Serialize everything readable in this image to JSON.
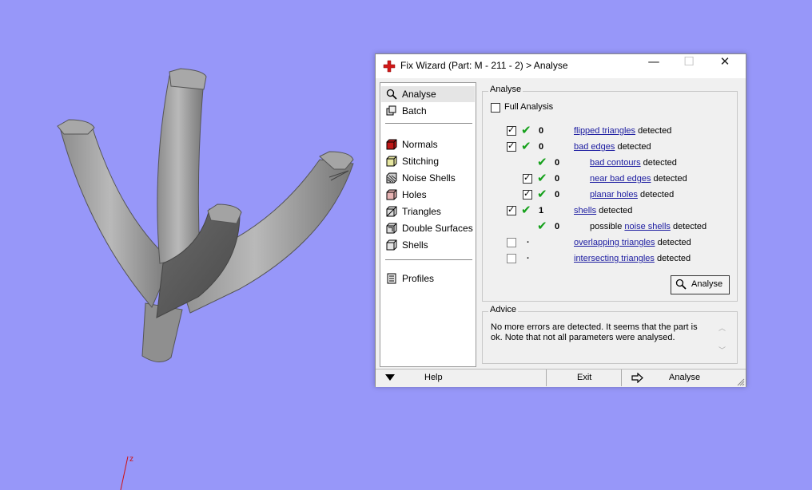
{
  "viewport": {
    "axis_label": "z"
  },
  "window": {
    "title": "Fix Wizard (Part: M - 211 - 2) > Analyse",
    "minimize_glyph": "—",
    "maximize_glyph": "☐",
    "close_glyph": "✕"
  },
  "sidebar": {
    "items": [
      {
        "label": "Analyse",
        "icon": "magnifier-icon"
      },
      {
        "label": "Batch",
        "icon": "batch-icon"
      },
      {
        "label": "Normals",
        "icon": "normals-cube-icon"
      },
      {
        "label": "Stitching",
        "icon": "stitching-cube-icon"
      },
      {
        "label": "Noise Shells",
        "icon": "noise-shells-icon"
      },
      {
        "label": "Holes",
        "icon": "holes-cube-icon"
      },
      {
        "label": "Triangles",
        "icon": "triangles-cube-icon"
      },
      {
        "label": "Double Surfaces",
        "icon": "double-surfaces-icon"
      },
      {
        "label": "Shells",
        "icon": "shells-cube-icon"
      },
      {
        "label": "Profiles",
        "icon": "profiles-icon"
      }
    ]
  },
  "analyse": {
    "legend": "Analyse",
    "full_analysis_label": "Full Analysis",
    "rows": [
      {
        "count": "0",
        "link": "flipped triangles",
        "suffix": " detected",
        "prefix": ""
      },
      {
        "count": "0",
        "link": "bad edges",
        "suffix": " detected",
        "prefix": ""
      },
      {
        "count": "0",
        "link": "bad contours",
        "suffix": " detected",
        "prefix": ""
      },
      {
        "count": "0",
        "link": "near bad edges",
        "suffix": " detected",
        "prefix": ""
      },
      {
        "count": "0",
        "link": "planar holes",
        "suffix": " detected",
        "prefix": ""
      },
      {
        "count": "1",
        "link": "shells",
        "suffix": " detected",
        "prefix": ""
      },
      {
        "count": "0",
        "link": "noise shells",
        "suffix": " detected",
        "prefix": "possible "
      },
      {
        "count": ".",
        "link": "overlapping triangles",
        "suffix": " detected",
        "prefix": ""
      },
      {
        "count": ".",
        "link": "intersecting triangles",
        "suffix": " detected",
        "prefix": ""
      }
    ],
    "button_label": "Analyse"
  },
  "advice": {
    "legend": "Advice",
    "text": "No more errors are detected. It seems that the part is ok. Note that not all parameters were analysed."
  },
  "bottom": {
    "help_label": "Help",
    "exit_label": "Exit",
    "analyse_label": "Analyse"
  }
}
